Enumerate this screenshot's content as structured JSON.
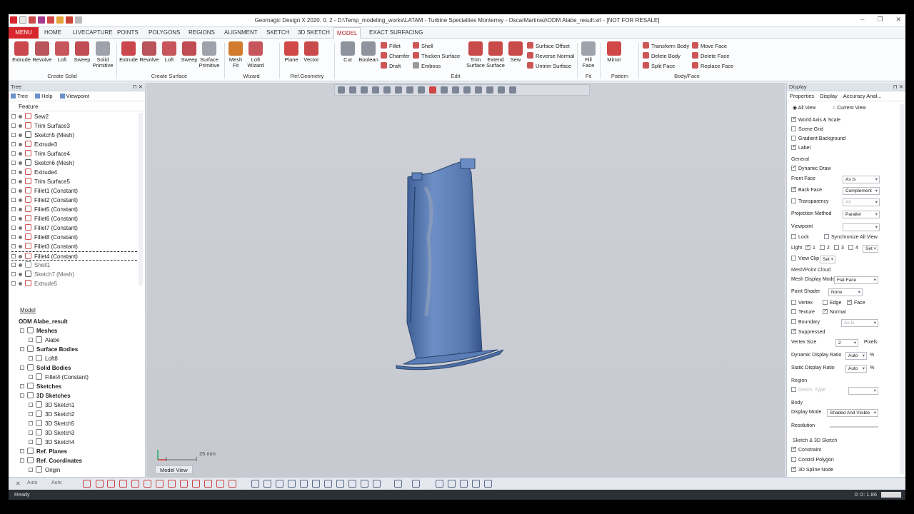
{
  "title": "Geomagic Design X 2020. 0. 2 - D:\\Temp_modeling_works\\LATAM - Turbine Specialties Monterrey - OscarMartinez\\ODM Alabe_result.xrl - [NOT FOR RESALE]",
  "window_controls": {
    "minimize": "–",
    "restore": "❐",
    "close": "✕"
  },
  "tabs": [
    "MENU",
    "HOME",
    "LIVECAPTURE",
    "POINTS",
    "POLYGONS",
    "REGIONS",
    "ALIGNMENT",
    "SKETCH",
    "3D SKETCH",
    "MODEL",
    "EXACT SURFACING"
  ],
  "ribbon": {
    "create_solid": [
      "Extrude",
      "Revolve",
      "Loft",
      "Sweep",
      "Solid Primitive"
    ],
    "create_surface": [
      "Extrude",
      "Revolve",
      "Loft",
      "Sweep",
      "Surface Primitive"
    ],
    "wizard": [
      "Mesh Fit",
      "Loft Wizard"
    ],
    "ref_geometry": [
      "Plane",
      "Vector"
    ],
    "edit_big": [
      "Cut",
      "Boolean"
    ],
    "edit_small": [
      "Fillet",
      "Chamfer",
      "Draft",
      "Shell",
      "Thicken Surface",
      "Emboss"
    ],
    "edit_big2": [
      "Trim Surface",
      "Extend Surface",
      "Sew"
    ],
    "edit_small2": [
      "Surface Offset",
      "Reverse Normal",
      "Untrim Surface"
    ],
    "fit": [
      "Fill Face"
    ],
    "pattern": [
      "Mirror"
    ],
    "body_face": [
      "Transform Body",
      "Delete Body",
      "Split Face",
      "Move Face",
      "Delete Face",
      "Replace Face"
    ],
    "groups": [
      "Create Solid",
      "Create Surface",
      "Wizard",
      "Ref.Geometry",
      "Edit",
      "Fit",
      "Pattern",
      "Body/Face"
    ]
  },
  "tree_panel": {
    "title": "Tree",
    "tabs": [
      "Tree",
      "Help",
      "Viewpoint"
    ],
    "feature_label": "Feature",
    "features": [
      "Sew2",
      "Trim Surface3",
      "Sketch5 (Mesh)",
      "Extrude3",
      "Trim Surface4",
      "Sketch6 (Mesh)",
      "Extrude4",
      "Trim Surface5",
      "Fillet1 (Constant)",
      "Fillet2 (Constant)",
      "Fillet5 (Constant)",
      "Fillet6 (Constant)",
      "Fillet7 (Constant)",
      "Fillet8 (Constant)",
      "Fillet3 (Constant)",
      "Fillet4 (Constant)",
      "Shell1",
      "Sketch7 (Mesh)",
      "Extrude5"
    ],
    "model_label": "Model",
    "model": [
      {
        "label": "ODM Alabe_result",
        "level": 0,
        "bold": true
      },
      {
        "label": "Meshes",
        "level": 1,
        "bold": true
      },
      {
        "label": "Alabe",
        "level": 2
      },
      {
        "label": "Surface Bodies",
        "level": 1,
        "bold": true
      },
      {
        "label": "Loft8",
        "level": 2
      },
      {
        "label": "Solid Bodies",
        "level": 1,
        "bold": true
      },
      {
        "label": "Fillet4 (Constant)",
        "level": 2
      },
      {
        "label": "Sketches",
        "level": 1,
        "bold": true
      },
      {
        "label": "3D Sketches",
        "level": 1,
        "bold": true
      },
      {
        "label": "3D Sketch1",
        "level": 2
      },
      {
        "label": "3D Sketch2",
        "level": 2
      },
      {
        "label": "3D Sketch5",
        "level": 2
      },
      {
        "label": "3D Sketch3",
        "level": 2
      },
      {
        "label": "3D Sketch4",
        "level": 2
      },
      {
        "label": "Ref. Planes",
        "level": 1,
        "bold": true
      },
      {
        "label": "Ref. Coordinates",
        "level": 1,
        "bold": true
      },
      {
        "label": "Origin",
        "level": 2
      }
    ]
  },
  "viewport": {
    "scale_label": "25 mm",
    "tab_label": "Model View"
  },
  "display_panel": {
    "title": "Display",
    "tabs": [
      "Properties",
      "Display",
      "Accuracy Anal..."
    ],
    "view_options": [
      "All View",
      "Current View"
    ],
    "checks": [
      "World Axis & Scale",
      "Scene Grid",
      "Gradient Background",
      "Label"
    ],
    "general": "General",
    "dynamic_draw": "Dynamic Draw",
    "front_face_label": "Front Face",
    "front_face_value": "As Is",
    "back_face_label": "Back Face",
    "back_face_value": "Complement",
    "transparency_label": "Transparency",
    "transparency_value": "All",
    "projection_label": "Projection Method",
    "projection_value": "Parallel",
    "viewpoint_label": "Viewpoint",
    "lock": "Lock",
    "sync": "Synchronize All View",
    "light_label": "Light",
    "lights": [
      "1",
      "2",
      "3",
      "4"
    ],
    "set": "Set",
    "view_clip": "View Clip",
    "mesh_section": "Mesh/Point Cloud",
    "mesh_mode_label": "Mesh Display Mode",
    "mesh_mode_value": "Flat Face",
    "point_shader_label": "Point Shader",
    "point_shader_value": "None",
    "vertex": "Vertex",
    "edge": "Edge",
    "face": "Face",
    "texture": "Texture",
    "normal": "Normal",
    "boundary": "Boundary",
    "boundary_value": "As Is",
    "suppressed": "Suppressed",
    "vertex_size_label": "Vertex Size",
    "vertex_size_value": "2",
    "pixels": "Pixels",
    "dyn_ratio_label": "Dynamic Display Ratio",
    "dyn_ratio_value": "Auto",
    "static_ratio_label": "Static Display Ratio",
    "static_ratio_value": "Auto",
    "percent": "%",
    "region_section": "Region",
    "region_value": "Geom. Type",
    "body_section": "Body",
    "display_mode_label": "Display Mode",
    "display_mode_value": "Shaded And Visible",
    "resolution_label": "Resolution",
    "sketch_section": "Sketch & 3D Sketch",
    "constraint": "Constraint",
    "control_polygon": "Control Polygon",
    "spline_node": "3D Spline Node"
  },
  "bottom_toolbar": {
    "auto1": "Auto",
    "auto2": "Auto"
  },
  "status": {
    "left": "Ready",
    "right": "0: 0: 1.86"
  },
  "colors": {
    "accent": "#d8262e",
    "blade": "#5b7fb6",
    "viewport": "#c9ccd2"
  }
}
